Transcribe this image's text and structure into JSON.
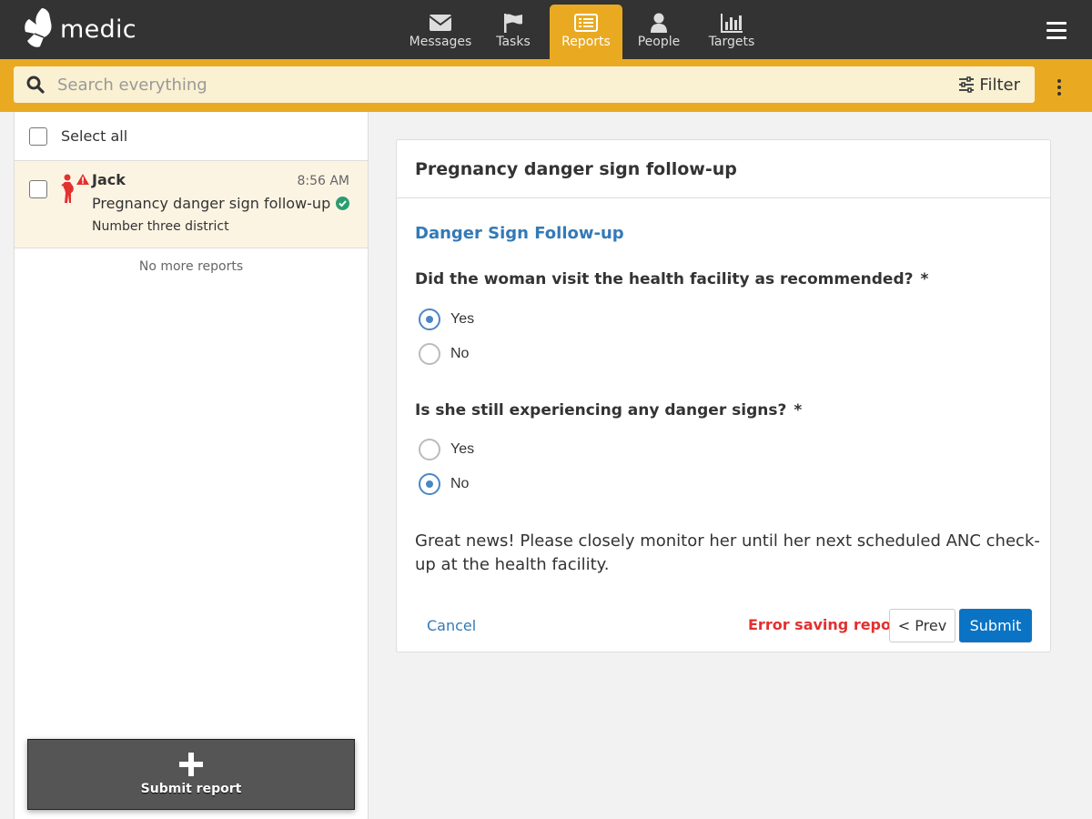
{
  "app": {
    "logo_text": "medic"
  },
  "nav": {
    "messages": "Messages",
    "tasks": "Tasks",
    "reports": "Reports",
    "people": "People",
    "targets": "Targets"
  },
  "search": {
    "placeholder": "Search everything",
    "value": "",
    "filter_label": "Filter"
  },
  "list": {
    "select_all_label": "Select all",
    "items": [
      {
        "name": "Jack",
        "time": "8:56 AM",
        "form": "Pregnancy danger sign follow-up",
        "place": "Number three district",
        "verified": true
      }
    ],
    "end_text": "No more reports",
    "submit_report_label": "Submit report"
  },
  "form": {
    "title": "Pregnancy danger sign follow-up",
    "section_title": "Danger Sign Follow-up",
    "questions": [
      {
        "label": "Did the woman visit the health facility as recommended?",
        "required_mark": "*",
        "options": [
          "Yes",
          "No"
        ],
        "selected": "Yes"
      },
      {
        "label": "Is she still experiencing any danger signs?",
        "required_mark": "*",
        "options": [
          "Yes",
          "No"
        ],
        "selected": "No"
      }
    ],
    "note": "Great news! Please closely monitor her until her next scheduled ANC check-up at the health facility.",
    "cancel_label": "Cancel",
    "error_text": "Error saving report",
    "prev_label": "< Prev",
    "submit_label": "Submit"
  },
  "colors": {
    "header_bg": "#333333",
    "accent": "#e9aa22",
    "search_bg": "#faf0d2",
    "link": "#337ab7",
    "error": "#e33030",
    "primary_button": "#0a73c4",
    "radio_checked": "#4a86c5",
    "verified": "#2a9d70",
    "danger_icon": "#e33030"
  }
}
